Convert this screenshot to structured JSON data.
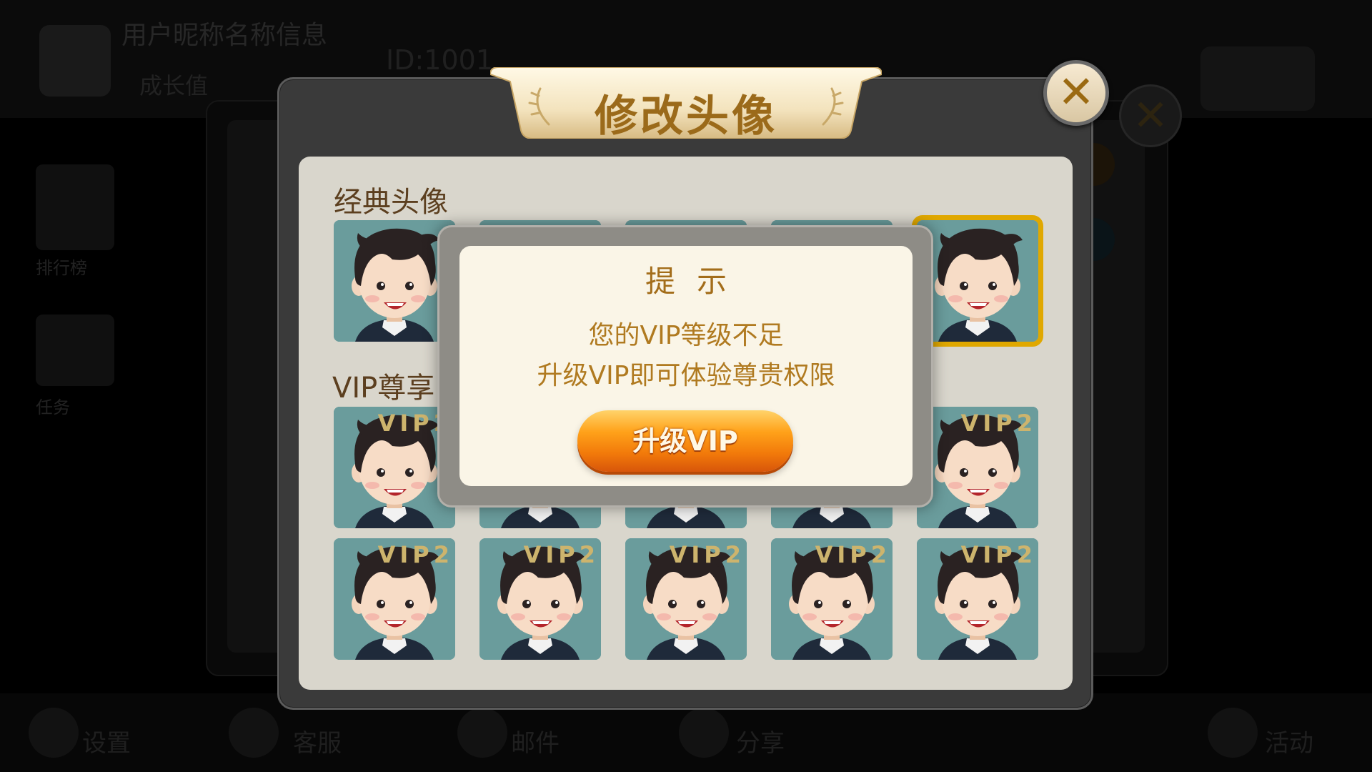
{
  "background": {
    "player_name": "用户昵称名称信息",
    "player_sub": "成长值",
    "player_id": "ID:1001",
    "left_items": [
      "排行榜",
      "任务"
    ],
    "bottom_items": [
      "设置",
      "客服",
      "邮件",
      "分享",
      "活动"
    ]
  },
  "dialog": {
    "title": "修改头像",
    "close_icon": "close-icon",
    "classic_label": "经典头像",
    "vip_label": "VIP尊享",
    "classic_count": 5,
    "selected_classic_index": 4,
    "vip_badge": "VIP2",
    "vip_count": 10
  },
  "tip": {
    "title": "提示",
    "line1": "您的VIP等级不足",
    "line2": "升级VIP即可体验尊贵权限",
    "button_label": "升级VIP"
  },
  "colors": {
    "title_gold": "#9b6a1a",
    "tile_bg": "#6a9c9c",
    "selected_border": "#e0a800",
    "check_mark": "#e8641a",
    "button_orange": "#f27a0a"
  }
}
